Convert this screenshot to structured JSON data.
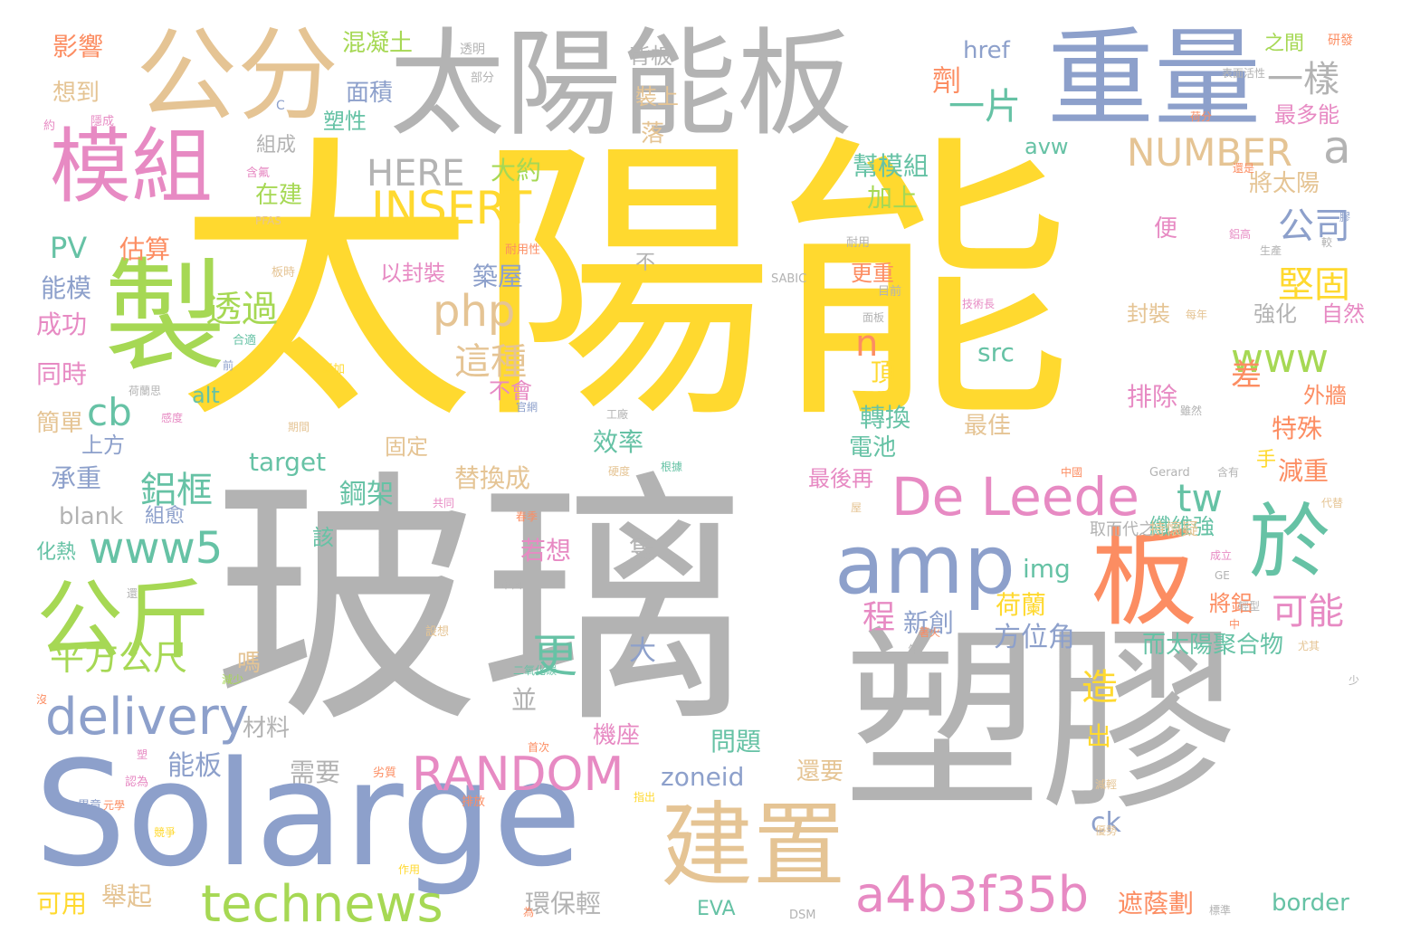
{
  "palette": {
    "yellow": "#ffd92f",
    "gray": "#b3b3b3",
    "blue": "#8da0cb",
    "tan": "#e5c494",
    "green": "#a6d854",
    "pink": "#e78ac3",
    "orange": "#fc8d62",
    "teal": "#66c2a5"
  },
  "words": [
    {
      "text": "太陽能"
    },
    {
      "text": "玻璃"
    },
    {
      "text": "塑膠"
    },
    {
      "text": "Solarge"
    },
    {
      "text": "太陽能板"
    },
    {
      "text": "重量"
    },
    {
      "text": "公分"
    },
    {
      "text": "模組"
    },
    {
      "text": "製"
    },
    {
      "text": "板"
    },
    {
      "text": "於"
    },
    {
      "text": "amp"
    },
    {
      "text": "公斤"
    },
    {
      "text": "建置"
    },
    {
      "text": "De Leede"
    },
    {
      "text": "technews"
    },
    {
      "text": "a4b3f35b"
    },
    {
      "text": "delivery"
    },
    {
      "text": "www5"
    },
    {
      "text": "RANDOM"
    },
    {
      "text": "INSERT"
    },
    {
      "text": "HERE"
    },
    {
      "text": "NUMBER"
    },
    {
      "text": "php"
    },
    {
      "text": "一片"
    },
    {
      "text": "一樣"
    },
    {
      "text": "a"
    },
    {
      "text": "www"
    },
    {
      "text": "cb"
    },
    {
      "text": "平方公尺"
    },
    {
      "text": "鋁框"
    },
    {
      "text": "透過"
    },
    {
      "text": "這種"
    },
    {
      "text": "更"
    },
    {
      "text": "tw"
    },
    {
      "text": "n"
    },
    {
      "text": "公司"
    },
    {
      "text": "堅固"
    },
    {
      "text": "可能"
    },
    {
      "text": "差"
    },
    {
      "text": "造"
    },
    {
      "text": "面積"
    },
    {
      "text": "背板"
    },
    {
      "text": "混凝土"
    },
    {
      "text": "影響"
    },
    {
      "text": "想到"
    },
    {
      "text": "塑性"
    },
    {
      "text": "組成"
    },
    {
      "text": "在建"
    },
    {
      "text": "大約"
    },
    {
      "text": "估算"
    },
    {
      "text": "PV"
    },
    {
      "text": "能模"
    },
    {
      "text": "成功"
    },
    {
      "text": "同時"
    },
    {
      "text": "簡單"
    },
    {
      "text": "承重"
    },
    {
      "text": "blank"
    },
    {
      "text": "組愈"
    },
    {
      "text": "化熱"
    },
    {
      "text": "上方"
    },
    {
      "text": "alt"
    },
    {
      "text": "target"
    },
    {
      "text": "以封裝"
    },
    {
      "text": "築屋"
    },
    {
      "text": "不會"
    },
    {
      "text": "固定"
    },
    {
      "text": "效率"
    },
    {
      "text": "替換成"
    },
    {
      "text": "鋼架"
    },
    {
      "text": "若想"
    },
    {
      "text": "該"
    },
    {
      "text": "材料"
    },
    {
      "text": "能板"
    },
    {
      "text": "嗎"
    },
    {
      "text": "程"
    },
    {
      "text": "新創"
    },
    {
      "text": "方位角"
    },
    {
      "text": "荷蘭"
    },
    {
      "text": "而太陽聚合物"
    },
    {
      "text": "機座"
    },
    {
      "text": "問題"
    },
    {
      "text": "需要"
    },
    {
      "text": "zoneid"
    },
    {
      "text": "還要"
    },
    {
      "text": "ck"
    },
    {
      "text": "環保輕"
    },
    {
      "text": "舉起"
    },
    {
      "text": "可用"
    },
    {
      "text": "EVA"
    },
    {
      "text": "border"
    },
    {
      "text": "遮蔭劃"
    },
    {
      "text": "href"
    },
    {
      "text": "劑"
    },
    {
      "text": "avw"
    },
    {
      "text": "最多能"
    },
    {
      "text": "之間"
    },
    {
      "text": "研發"
    },
    {
      "text": "幫模組"
    },
    {
      "text": "將太陽"
    },
    {
      "text": "加上"
    },
    {
      "text": "便"
    },
    {
      "text": "更重"
    },
    {
      "text": "封裝"
    },
    {
      "text": "強化"
    },
    {
      "text": "自然"
    },
    {
      "text": "src"
    },
    {
      "text": "頂"
    },
    {
      "text": "排除"
    },
    {
      "text": "外牆"
    },
    {
      "text": "特殊"
    },
    {
      "text": "轉換"
    },
    {
      "text": "電池"
    },
    {
      "text": "最佳"
    },
    {
      "text": "最後再"
    },
    {
      "text": "減重"
    },
    {
      "text": "手"
    },
    {
      "text": "出"
    },
    {
      "text": "纖維強"
    },
    {
      "text": "取而代之"
    },
    {
      "text": "持懷疑"
    },
    {
      "text": "img"
    },
    {
      "text": "將鋁"
    },
    {
      "text": "隻"
    },
    {
      "text": "並"
    },
    {
      "text": "大"
    },
    {
      "text": "落"
    },
    {
      "text": "裝上"
    },
    {
      "text": "透明"
    },
    {
      "text": "部分"
    },
    {
      "text": "C"
    },
    {
      "text": "約"
    },
    {
      "text": "隱成"
    },
    {
      "text": "含氟"
    },
    {
      "text": "PFAS"
    },
    {
      "text": "耐用性"
    },
    {
      "text": "板時"
    },
    {
      "text": "不"
    },
    {
      "text": "SABIC"
    },
    {
      "text": "耐用"
    },
    {
      "text": "目前"
    },
    {
      "text": "面板"
    },
    {
      "text": "合適"
    },
    {
      "text": "前"
    },
    {
      "text": "添加"
    },
    {
      "text": "荷蘭思"
    },
    {
      "text": "感度"
    },
    {
      "text": "期間"
    },
    {
      "text": "官網"
    },
    {
      "text": "工廠"
    },
    {
      "text": "硬度"
    },
    {
      "text": "共同"
    },
    {
      "text": "春季"
    },
    {
      "text": "市面上"
    },
    {
      "text": "設想"
    },
    {
      "text": "二氧化碳"
    },
    {
      "text": "首次"
    },
    {
      "text": "劣質"
    },
    {
      "text": "認為"
    },
    {
      "text": "畢竟"
    },
    {
      "text": "元學"
    },
    {
      "text": "競爭"
    },
    {
      "text": "排放"
    },
    {
      "text": "作用"
    },
    {
      "text": "為"
    },
    {
      "text": "DSM"
    },
    {
      "text": "指出"
    },
    {
      "text": "還"
    },
    {
      "text": "沒"
    },
    {
      "text": "減少"
    },
    {
      "text": "塑"
    },
    {
      "text": "著火"
    },
    {
      "text": "年"
    },
    {
      "text": "表面活性"
    },
    {
      "text": "荷分"
    },
    {
      "text": "膠"
    },
    {
      "text": "還是"
    },
    {
      "text": "鋁高"
    },
    {
      "text": "較"
    },
    {
      "text": "生產"
    },
    {
      "text": "技術長"
    },
    {
      "text": "每年"
    },
    {
      "text": "雖然"
    },
    {
      "text": "根據"
    },
    {
      "text": "中國"
    },
    {
      "text": "Gerard"
    },
    {
      "text": "含有"
    },
    {
      "text": "代替"
    },
    {
      "text": "屋"
    },
    {
      "text": "成立"
    },
    {
      "text": "GE"
    },
    {
      "text": "輕型"
    },
    {
      "text": "中"
    },
    {
      "text": "尤其"
    },
    {
      "text": "少"
    },
    {
      "text": "減輕"
    },
    {
      "text": "優勢"
    },
    {
      "text": "標準"
    }
  ]
}
